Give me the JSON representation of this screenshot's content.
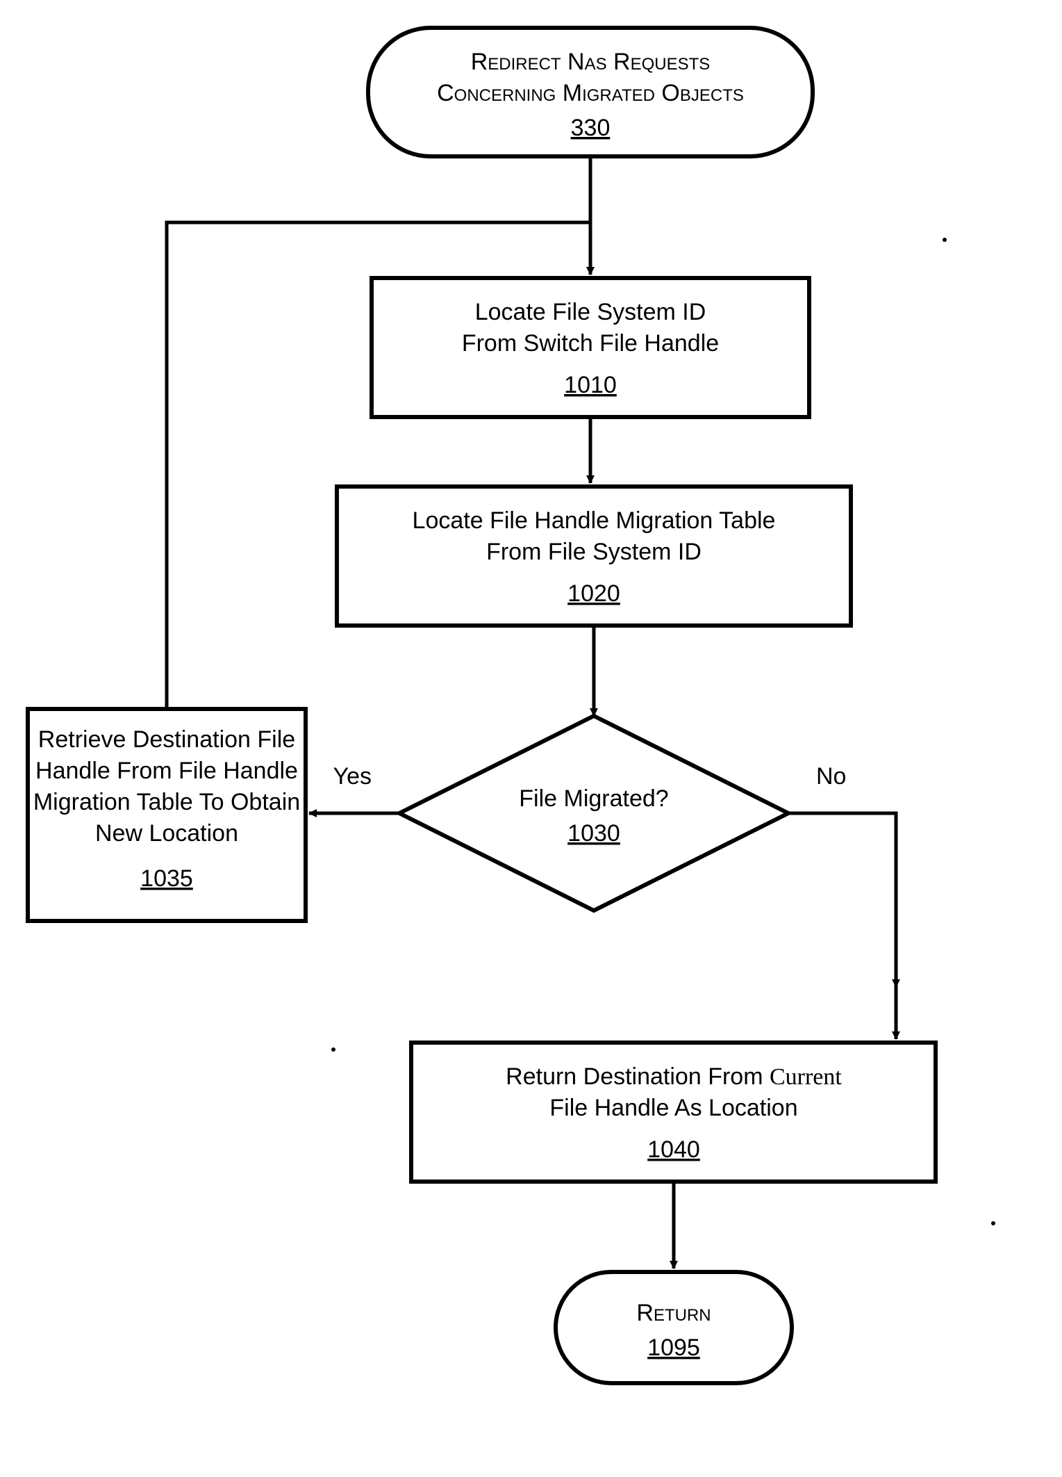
{
  "nodes": {
    "start": {
      "line1": "Redirect Nas Requests",
      "line2": "Concerning Migrated Objects",
      "ref": "330"
    },
    "step1": {
      "line1": "Locate File System ID",
      "line2": "From Switch File Handle",
      "ref": "1010"
    },
    "step2": {
      "line1": "Locate File Handle Migration Table",
      "line2": "From File System ID",
      "ref": "1020"
    },
    "decision": {
      "line1": "File Migrated?",
      "ref": "1030"
    },
    "step_yes": {
      "line1": "Retrieve Destination File",
      "line2": "Handle From File Handle",
      "line3": "Migration Table To Obtain",
      "line4": "New Location",
      "ref": "1035"
    },
    "step_no": {
      "line1a": "Return Destination From ",
      "line1b": "Current",
      "line2": "File Handle As Location",
      "ref": "1040"
    },
    "end": {
      "line1": "Return",
      "ref": "1095"
    }
  },
  "labels": {
    "yes": "Yes",
    "no": "No"
  }
}
